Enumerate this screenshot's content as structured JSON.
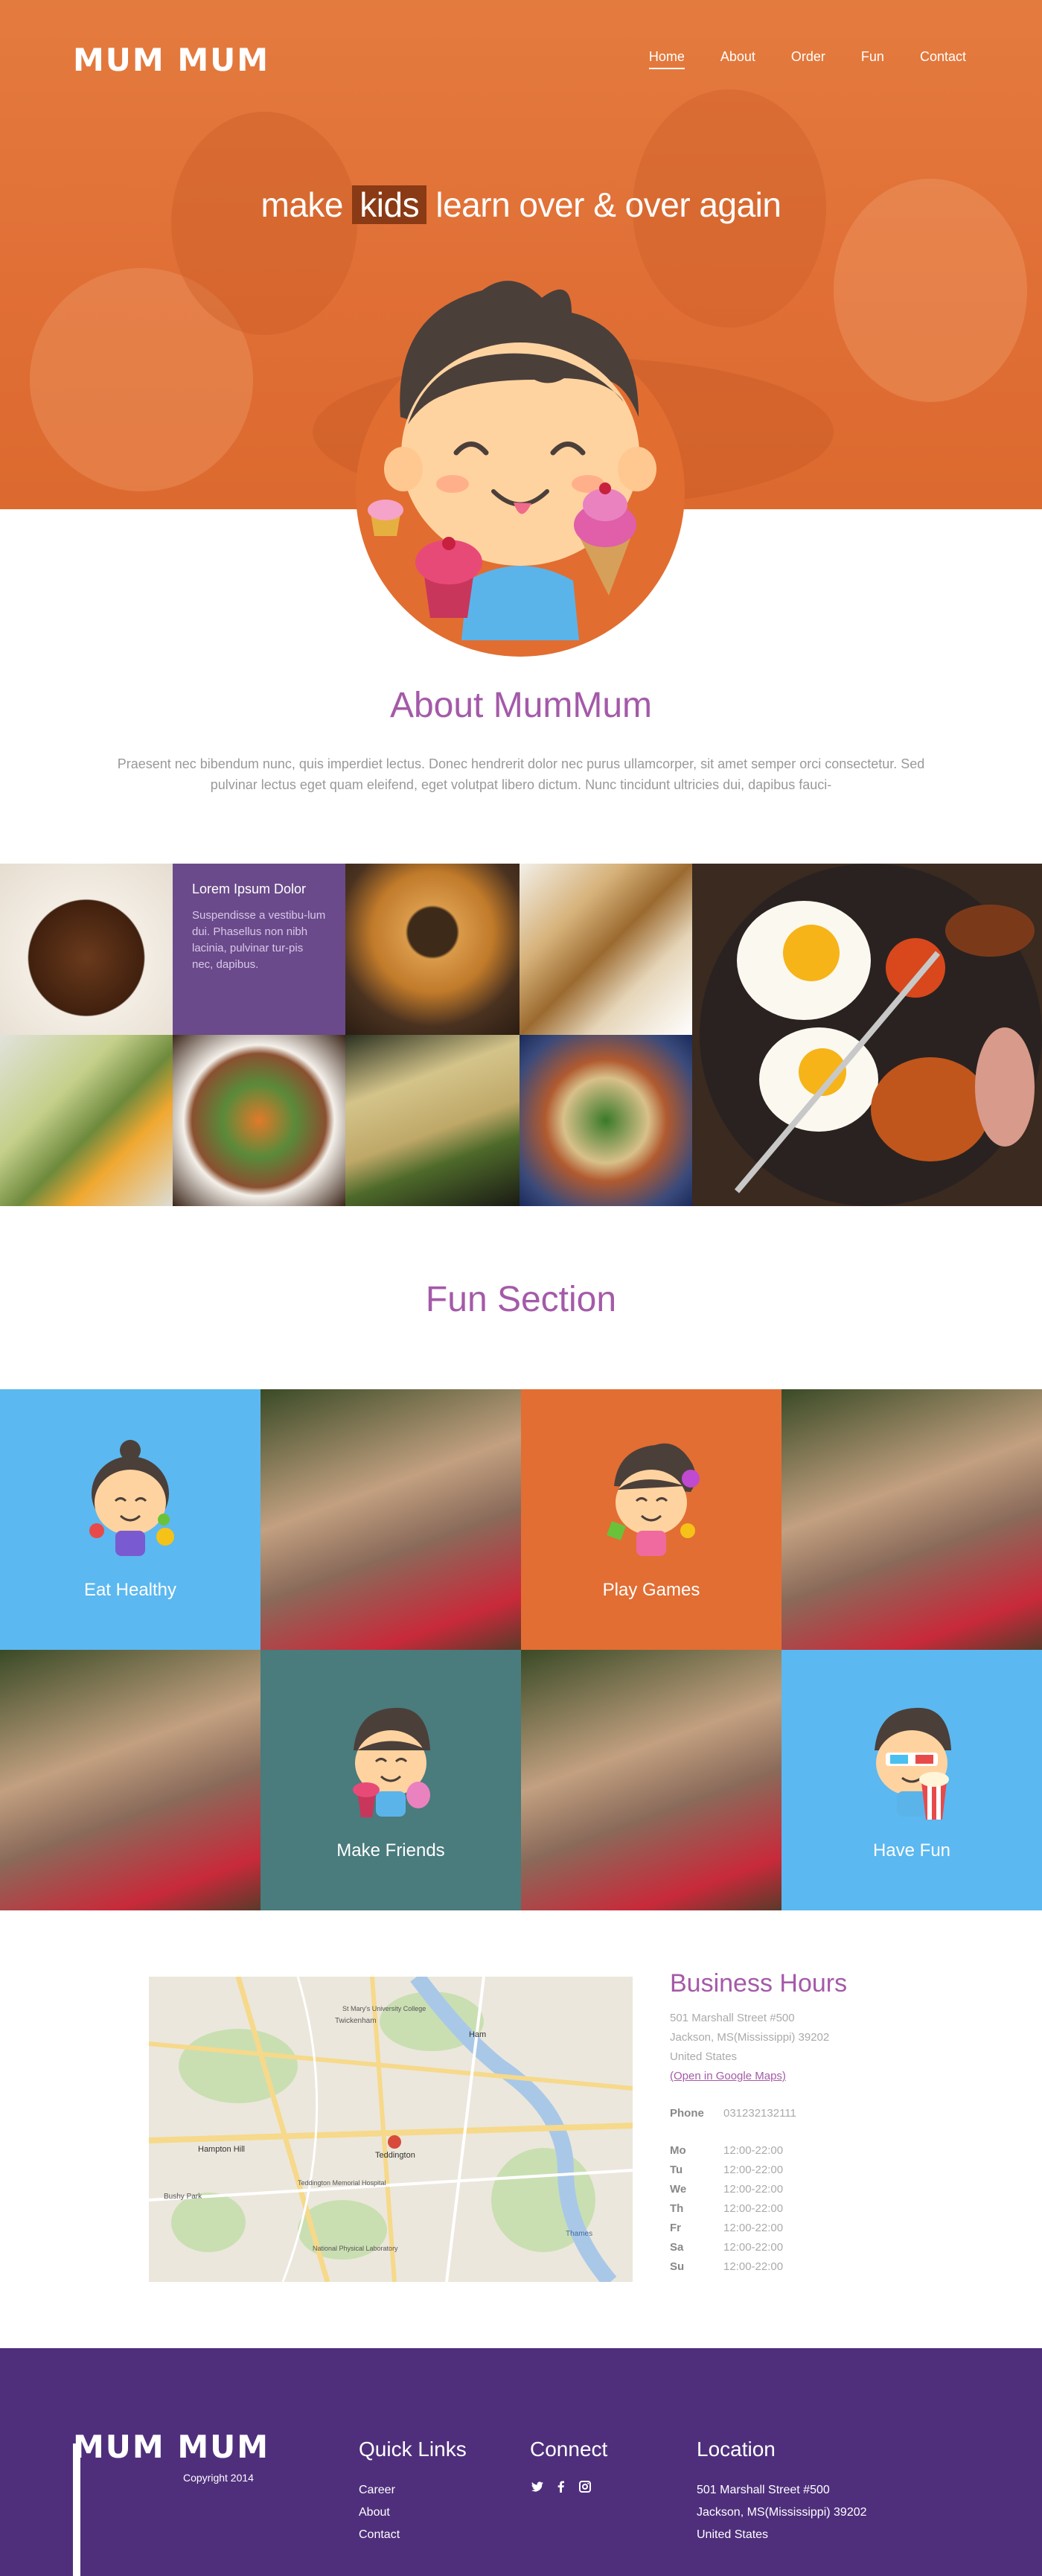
{
  "brand": {
    "logo": "MUM MUM"
  },
  "nav": {
    "items": [
      {
        "label": "Home",
        "active": true
      },
      {
        "label": "About",
        "active": false
      },
      {
        "label": "Order",
        "active": false
      },
      {
        "label": "Fun",
        "active": false
      },
      {
        "label": "Contact",
        "active": false
      }
    ]
  },
  "hero": {
    "tagline_pre": "make",
    "tagline_highlight": "kids",
    "tagline_post": "learn over & over again"
  },
  "about": {
    "title": "About MumMum",
    "text": "Praesent nec bibendum nunc, quis imperdiet lectus. Donec hendrerit dolor nec purus ullamcorper, sit amet semper orci consectetur. Sed pulvinar lectus eget quam eleifend, eget volutpat libero dictum. Nunc tincidunt ultricies dui, dapibus fauci-"
  },
  "gallery": {
    "caption_title": "Lorem Ipsum Dolor",
    "caption_text": "Suspendisse a vestibu-lum dui. Phasellus non nibh lacinia, pulvinar tur-pis nec, dapibus."
  },
  "fun": {
    "title": "Fun Section",
    "cells": [
      {
        "label": "Eat Healthy"
      },
      {
        "label": "Play Games"
      },
      {
        "label": "Make Friends"
      },
      {
        "label": "Have Fun"
      }
    ]
  },
  "hours": {
    "title": "Business Hours",
    "address_line1": "501 Marshall Street #500",
    "address_line2": "Jackson, MS(Mississippi) 39202",
    "address_line3": "United States",
    "map_link": "(Open in Google Maps)",
    "phone_label": "Phone",
    "phone": "031232132111",
    "days": [
      {
        "day": "Mo",
        "time": "12:00-22:00"
      },
      {
        "day": "Tu",
        "time": "12:00-22:00"
      },
      {
        "day": "We",
        "time": "12:00-22:00"
      },
      {
        "day": "Th",
        "time": "12:00-22:00"
      },
      {
        "day": "Fr",
        "time": "12:00-22:00"
      },
      {
        "day": "Sa",
        "time": "12:00-22:00"
      },
      {
        "day": "Su",
        "time": "12:00-22:00"
      }
    ]
  },
  "map": {
    "labels": [
      "Teddington",
      "Hampton Hill",
      "Ham",
      "Twickenham",
      "St Mary's University College",
      "Teddington Memorial Hospital",
      "National Physical Laboratory",
      "Bushy Park",
      "Thames"
    ]
  },
  "footer": {
    "logo": "MUM MUM",
    "copyright": "Copyright 2014",
    "quick_links_title": "Quick Links",
    "quick_links": [
      "Career",
      "About",
      "Contact"
    ],
    "connect_title": "Connect",
    "location_title": "Location",
    "location_line1": "501 Marshall Street #500",
    "location_line2": "Jackson, MS(Mississippi) 39202",
    "location_line3": "United States"
  },
  "colors": {
    "accent": "#a45aa8",
    "hero_orange": "#e27339",
    "footer_purple": "#4f2f7c",
    "fun_blue": "#5bb8f0",
    "fun_orange": "#e26e33",
    "fun_teal": "#4a7b7d"
  },
  "icons": {
    "connect": [
      "twitter-icon",
      "facebook-icon",
      "instagram-icon"
    ]
  }
}
